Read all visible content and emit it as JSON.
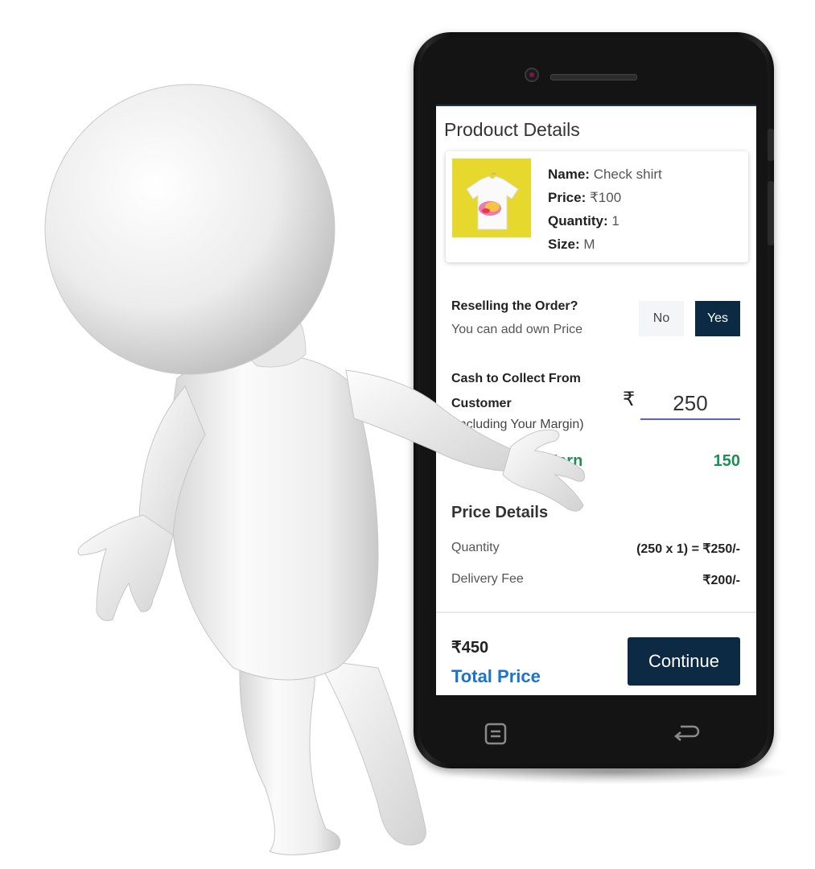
{
  "product_details": {
    "title": "Prodouct Details",
    "name_label": "Name:",
    "name_value": "Check shirt",
    "price_label": "Price:",
    "price_value": "₹100",
    "quantity_label": "Quantity:",
    "quantity_value": "1",
    "size_label": "Size:",
    "size_value": "M"
  },
  "reselling": {
    "question": "Reselling the Order?",
    "subtitle": "You can add own Price",
    "no_label": "No",
    "yes_label": "Yes",
    "selected": "Yes"
  },
  "cash": {
    "label": "Cash to Collect From Customer",
    "sublabel": "(Including Your Margin)",
    "currency_symbol": "₹",
    "value": "250"
  },
  "earn": {
    "label": "You Earn",
    "value": "150"
  },
  "price_details": {
    "title": "Price Details",
    "rows": [
      {
        "label": "Quantity",
        "value": "(250 x 1) = ₹250/-"
      },
      {
        "label": "Delivery Fee",
        "value": "₹200/-"
      }
    ]
  },
  "footer": {
    "total_amount": "₹450",
    "total_label": "Total Price",
    "continue_label": "Continue"
  },
  "colors": {
    "primary_dark": "#0d2a45",
    "earn_green": "#1e8f55",
    "total_blue": "#1a73d1"
  },
  "icons": [
    "menu-nav-icon",
    "back-nav-icon"
  ]
}
